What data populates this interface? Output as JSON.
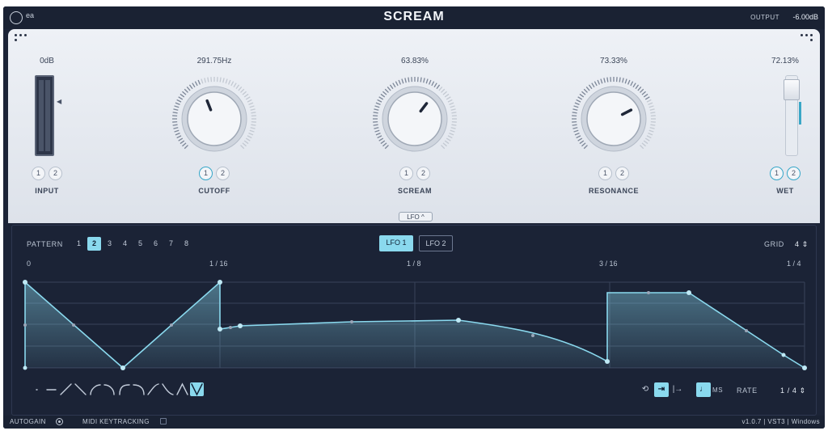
{
  "title": "SCREAM",
  "brand": {
    "logo_text": "ea"
  },
  "output": {
    "label": "OUTPUT",
    "value": "-6.00dB"
  },
  "modules": {
    "input": {
      "value": "0dB",
      "label": "INPUT",
      "slots": [
        "1",
        "2"
      ]
    },
    "cutoff": {
      "value": "291.75Hz",
      "label": "CUTOFF",
      "slots": [
        "1",
        "2"
      ],
      "knob_fraction": 0.42
    },
    "scream": {
      "value": "63.83%",
      "label": "SCREAM",
      "slots": [
        "1",
        "2"
      ],
      "knob_fraction": 0.6383
    },
    "resonance": {
      "value": "73.33%",
      "label": "RESONANCE",
      "slots": [
        "1",
        "2"
      ],
      "knob_fraction": 0.7333
    },
    "wet": {
      "value": "72.13%",
      "label": "WET",
      "slots": [
        "1",
        "2"
      ],
      "fraction": 0.7213
    }
  },
  "lfo_toggle": {
    "label": "LFO"
  },
  "lfo": {
    "pattern_label": "PATTERN",
    "patterns": [
      "1",
      "2",
      "3",
      "4",
      "5",
      "6",
      "7",
      "8"
    ],
    "selected_pattern": "2",
    "tabs": [
      "LFO 1",
      "LFO 2"
    ],
    "selected_tab": "LFO 1",
    "grid": {
      "label": "GRID",
      "value": "4"
    },
    "time_ticks": [
      "0",
      "1 / 16",
      "1 / 8",
      "3 / 16",
      "1 / 4"
    ],
    "rate": {
      "label": "RATE",
      "value": "1 / 4"
    },
    "ms_label": "MS",
    "shape_presets": [
      "dot",
      "flat",
      "ramp-up",
      "ramp-down",
      "curve-1",
      "curve-2",
      "curve-3",
      "curve-4",
      "curve-5",
      "curve-6",
      "triangle",
      "v-shape"
    ],
    "selected_shape": "v-shape"
  },
  "status": {
    "autogain": "AUTOGAIN",
    "midi_keytracking": "MIDI KEYTRACKING",
    "version": "v1.0.7 | VST3 | Windows"
  },
  "colors": {
    "accent": "#8ad9ee",
    "panel": "#e4e8ee",
    "dark": "#1b2336",
    "teal": "#35a6c8"
  }
}
